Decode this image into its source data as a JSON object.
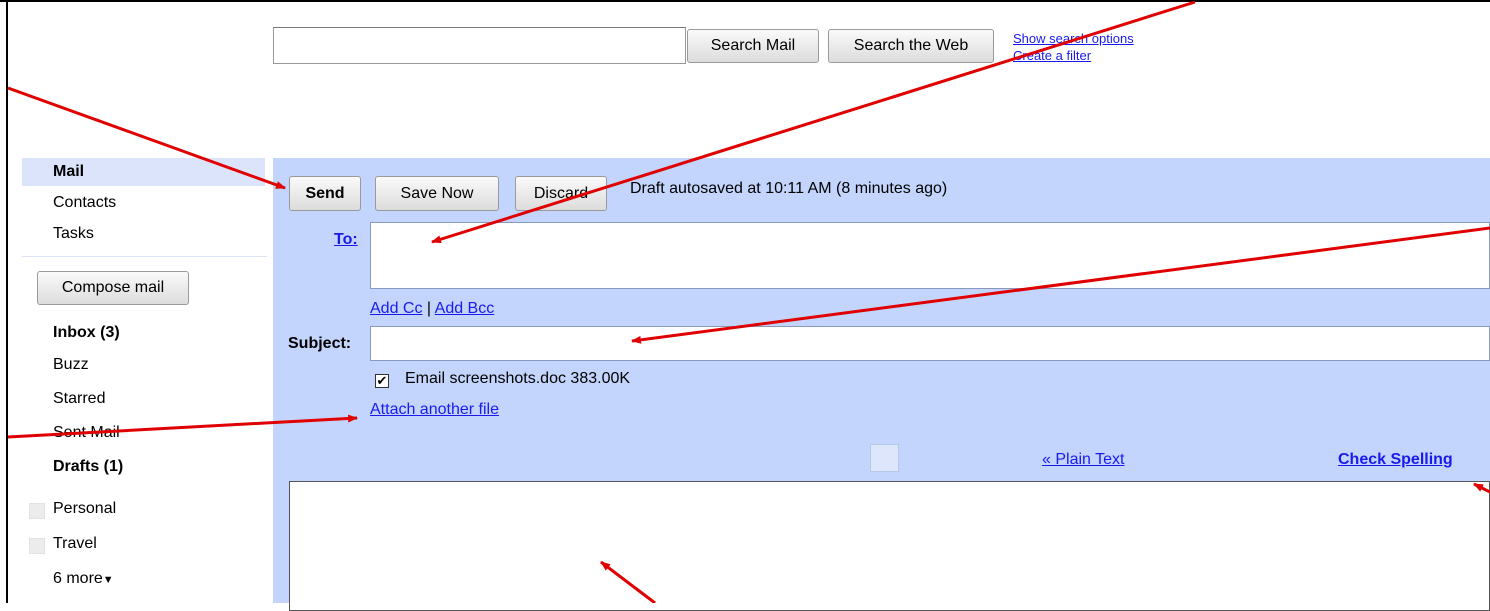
{
  "search": {
    "input_value": "",
    "search_mail_label": "Search Mail",
    "search_web_label": "Search the Web",
    "show_options_label": "Show search options",
    "create_filter_label": "Create a filter"
  },
  "sidebar": {
    "top_items": [
      {
        "label": "Mail",
        "selected": true
      },
      {
        "label": "Contacts"
      },
      {
        "label": "Tasks"
      }
    ],
    "compose_label": "Compose mail",
    "folders": [
      {
        "label": "Inbox (3)",
        "bold": true
      },
      {
        "label": "Buzz"
      },
      {
        "label": "Starred"
      },
      {
        "label": "Sent Mail"
      },
      {
        "label": "Drafts (1)",
        "bold": true
      }
    ],
    "labels": [
      {
        "label": "Personal"
      },
      {
        "label": "Travel"
      }
    ],
    "more_label": "6 more",
    "more_icon": "triangle-down"
  },
  "compose": {
    "send_label": "Send",
    "save_label": "Save Now",
    "discard_label": "Discard",
    "autosave_status": "Draft autosaved at 10:11 AM (8 minutes ago)",
    "to_label": "To:",
    "to_value": "",
    "add_cc_label": "Add Cc",
    "separator": "|",
    "add_bcc_label": "Add Bcc",
    "subject_label": "Subject:",
    "subject_value": "",
    "attachment": {
      "checked": true,
      "check_mark": "✔",
      "file_name": "Email screenshots.doc",
      "file_size": "383.00K"
    },
    "attach_another_label": "Attach another file",
    "plain_text_label": "« Plain Text",
    "check_spelling_label": "Check Spelling",
    "body_value": ""
  },
  "colors": {
    "panel_bg": "#c3d5fc",
    "link": "#1a1aee",
    "selected_nav": "#dbe4fb",
    "annotation_arrow": "#e00000"
  }
}
